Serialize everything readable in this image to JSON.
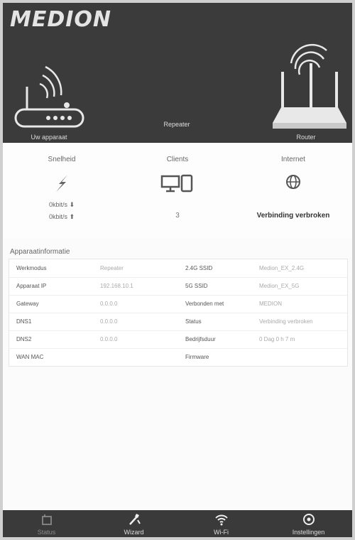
{
  "header": {
    "logo": "MEDION",
    "left_device": "Uw apparaat",
    "mode": "Repeater",
    "right_device": "Router"
  },
  "stats": {
    "snelheid": {
      "title": "Snelheid",
      "down": "0kbit/s",
      "up": "0kbit/s"
    },
    "clients": {
      "title": "Clients",
      "count": "3"
    },
    "internet": {
      "title": "Internet",
      "status": "Verbinding verbroken"
    }
  },
  "device_info": {
    "title": "Apparaatinformatie",
    "rows": [
      {
        "l1": "Werkmodus",
        "v1": "Repeater",
        "l2": "2.4G SSID",
        "v2": "Medion_EX_2.4G"
      },
      {
        "l1": "Apparaat IP",
        "v1": "192.168.10.1",
        "l2": "5G SSID",
        "v2": "Medion_EX_5G"
      },
      {
        "l1": "Gateway",
        "v1": "0.0.0.0",
        "l2": "Verbonden met",
        "v2": "MEDION"
      },
      {
        "l1": "DNS1",
        "v1": "0.0.0.0",
        "l2": "Status",
        "v2": "Verbinding verbroken"
      },
      {
        "l1": "DNS2",
        "v1": "0.0.0.0",
        "l2": "Bedrijfsduur",
        "v2": "0 Dag 0 h 7 m"
      },
      {
        "l1": "WAN MAC",
        "v1": "",
        "l2": "Firmware",
        "v2": ""
      }
    ]
  },
  "nav": {
    "items": [
      {
        "label": "Status",
        "active": false
      },
      {
        "label": "Wizard",
        "active": true
      },
      {
        "label": "Wi-Fi",
        "active": true
      },
      {
        "label": "Instellingen",
        "active": true
      }
    ]
  },
  "colors": {
    "header_bg": "#3b3b3b",
    "nav_bg": "#3a3a3a",
    "page_bg": "#fbfbfb"
  }
}
